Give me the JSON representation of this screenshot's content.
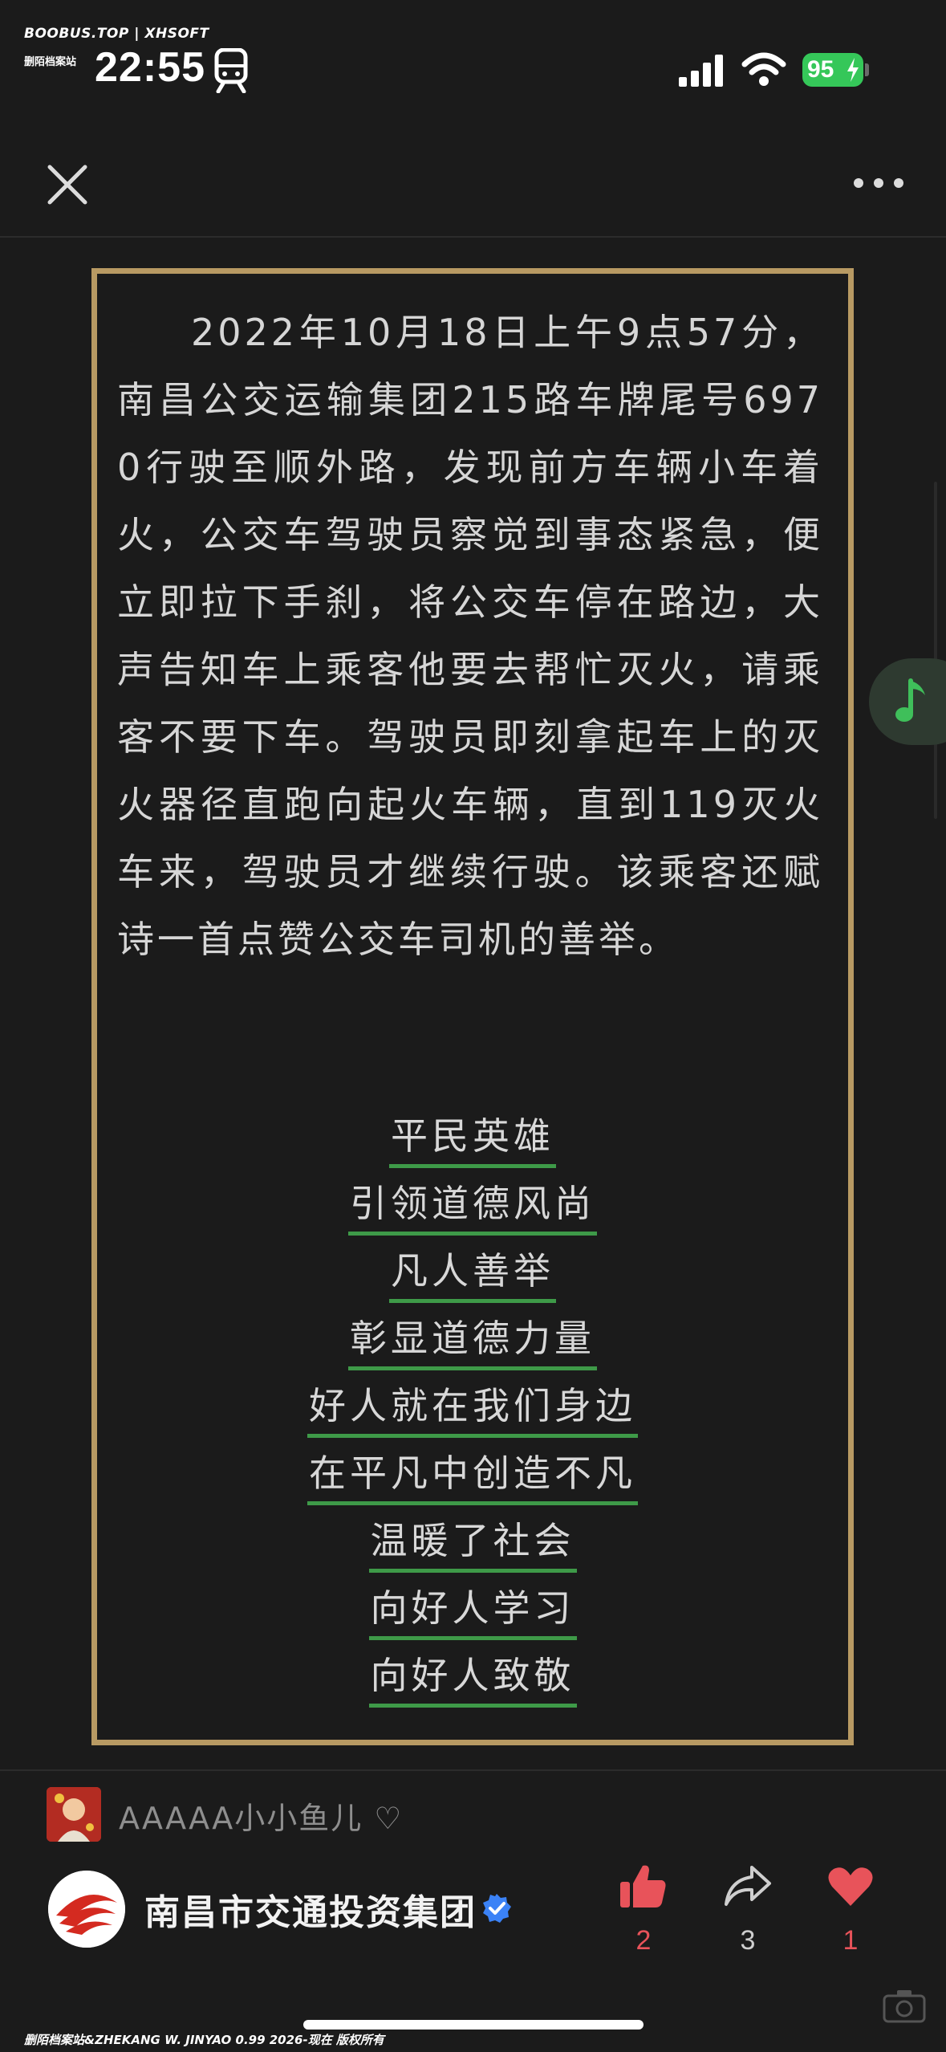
{
  "status_bar": {
    "watermark": "BOOBUS.TOP | XHSOFT",
    "watermark_sub": "删陌档案站",
    "time": "22:55",
    "battery": "95"
  },
  "post": {
    "paragraph": "2022年10月18日上午9点57分，南昌公交运输集团215路车牌尾号6970行驶至顺外路，发现前方车辆小车着火，公交车驾驶员察觉到事态紧急，便立即拉下手刹，将公交车停在路边，大声告知车上乘客他要去帮忙灭火，请乘客不要下车。驾驶员即刻拿起车上的灭火器径直跑向起火车辆，直到119灭火车来，驾驶员才继续行驶。该乘客还赋诗一首点赞公交车司机的善举。",
    "poem": [
      "平民英雄",
      "引领道德风尚",
      "凡人善举",
      "彰显道德力量",
      "好人就在我们身边",
      "在平凡中创造不凡",
      "温暖了社会",
      "向好人学习",
      "向好人致敬"
    ]
  },
  "footer": {
    "user_name": "AAAAA小小鱼儿 ♡",
    "org_name": "南昌市交通投资集团",
    "likes": "2",
    "shares": "3",
    "favorites": "1",
    "bottom_watermark": "删陌档案站&ZHEKANG W.  JINYAO 0.99 2026-现在 版权所有"
  },
  "colors": {
    "background": "#1b1b1b",
    "frame_border": "#b89a63",
    "poem_underline": "#3e9a48",
    "accent_red": "#e8535a",
    "battery_green": "#35c759"
  }
}
